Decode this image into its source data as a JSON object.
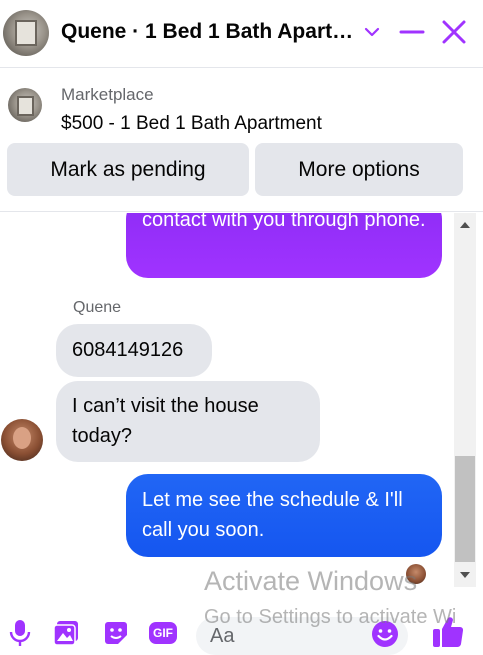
{
  "header": {
    "title": "Quene · 1 Bed 1 Bath Apart…",
    "avatar_icon": "apartment-photo",
    "chevron_icon": "chevron-down-icon",
    "minimize_icon": "minus-icon",
    "close_icon": "close-icon",
    "accent_color": "#a033ff"
  },
  "marketplace": {
    "label": "Marketplace",
    "listing": "$500 - 1 Bed 1 Bath Apartment",
    "mark_pending_label": "Mark as pending",
    "more_options_label": "More options"
  },
  "messages": {
    "outgoing_1": "contact with you through phone.",
    "sender_name": "Quene",
    "incoming_1": "6084149126",
    "incoming_2": "I can’t visit the house today?",
    "outgoing_2": "Let me see the schedule & I'll call you soon.",
    "purple_color": "#a033ff",
    "blue_color": "#1f65f5"
  },
  "watermark": {
    "line1": "Activate Windows",
    "line2": "Go to Settings to activate Wi"
  },
  "composer": {
    "placeholder": "Aa",
    "icons": [
      "mic-icon",
      "photo-icon",
      "sticker-icon",
      "gif-icon",
      "emoji-icon",
      "like-icon"
    ],
    "gif_text": "GIF"
  }
}
